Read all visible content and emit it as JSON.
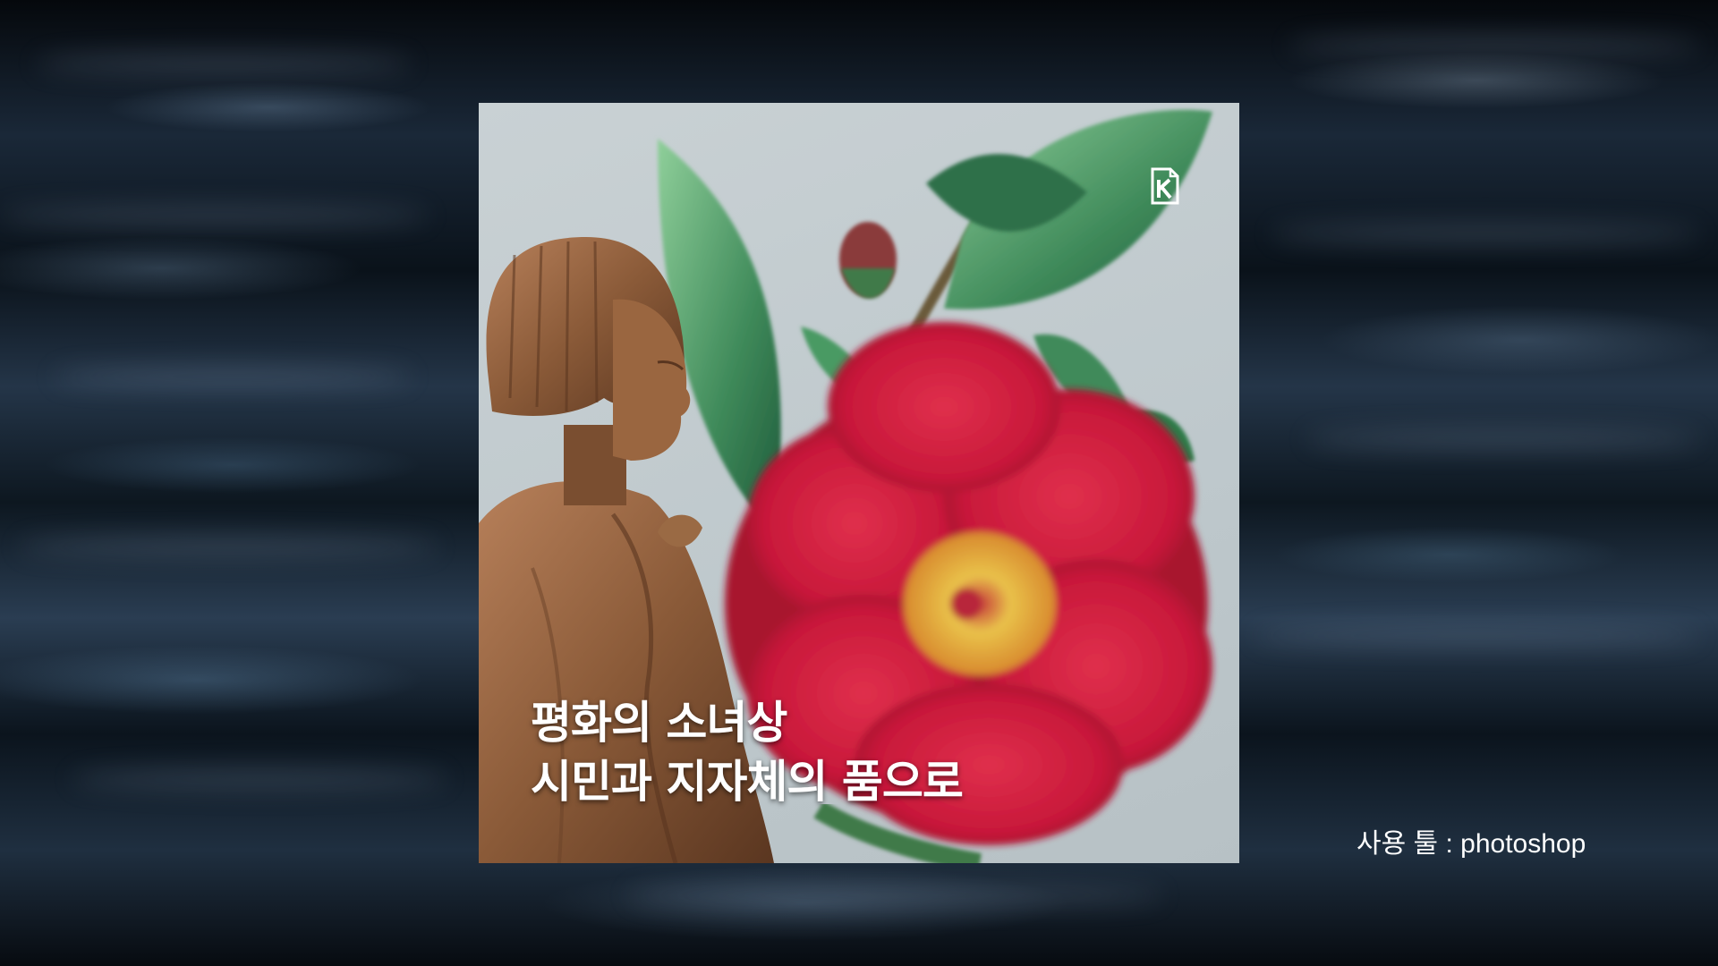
{
  "poster": {
    "headline_line1": "평화의 소녀상",
    "headline_line2": "시민과 지자체의 품으로",
    "logo_icon": "k-logo-icon"
  },
  "caption": {
    "text": "사용 툴 : photoshop"
  },
  "colors": {
    "background": "#0b1016",
    "poster_bg": "#c9d1d4",
    "flower_red": "#c8183a",
    "leaf_green": "#3f8a5a",
    "statue_bronze": "#8a5a38",
    "text": "#ffffff"
  }
}
